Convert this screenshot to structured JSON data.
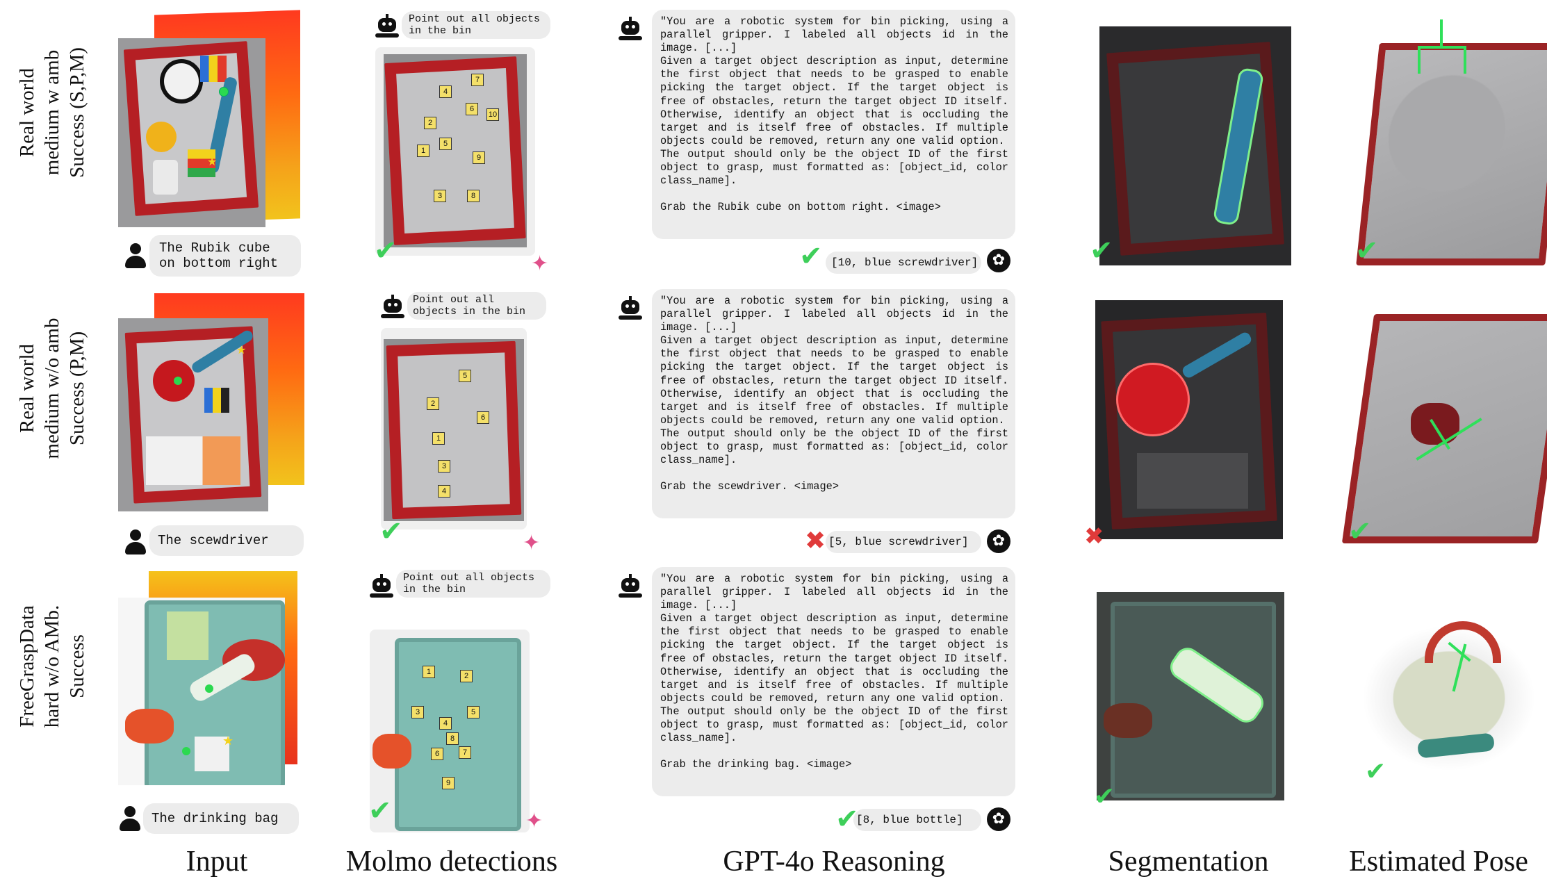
{
  "columns": {
    "input": "Input",
    "molmo": "Molmo detections",
    "gpt": "GPT-4o Reasoning",
    "seg": "Segmentation",
    "pose": "Estimated Pose"
  },
  "rows": [
    {
      "label": [
        "Real world",
        "medium w amb",
        "Success (S,P,M)"
      ],
      "user_query": [
        "The Rubik cube",
        "on bottom right"
      ],
      "molmo_prompt": [
        "Point out all objects",
        "in the bin"
      ],
      "gpt_prompt": "\"You are a robotic system for bin picking, using a parallel gripper. I labeled all objects id in the image. [...]\nGiven a target object description as input, determine the first object that needs to be grasped to enable picking the target object. If the target object is free of obstacles, return the target object ID itself. Otherwise, identify an object that is occluding the target and is itself free of obstacles. If multiple objects could be removed, return any one valid option.\nThe output should only be the object ID of the first object to grasp, must formatted as: [object_id, color class_name].\n\nGrab the Rubik cube on bottom right. <image>",
      "gpt_answer": "[10, blue screwdriver]",
      "gpt_mark": "check",
      "seg_mark": "check",
      "pose_mark": "check",
      "molmo_mark": "check",
      "tags": [
        "1",
        "2",
        "3",
        "4",
        "5",
        "6",
        "7",
        "8",
        "9",
        "10"
      ]
    },
    {
      "label": [
        "Real world",
        "medium w/o amb",
        "Success (P,M)"
      ],
      "user_query": [
        "The scewdriver"
      ],
      "molmo_prompt": [
        "Point out all",
        "objects in the bin"
      ],
      "gpt_prompt": "\"You are a robotic system for bin picking, using a parallel gripper. I labeled all objects id in the image. [...]\nGiven a target object description as input, determine the first object that needs to be grasped to enable picking the target object. If the target object is free of obstacles, return the target object ID itself. Otherwise, identify an object that is occluding the target and is itself free of obstacles. If multiple objects could be removed, return any one valid option.\nThe output should only be the object ID of the first object to grasp, must formatted as: [object_id, color class_name].\n\nGrab the scewdriver. <image>",
      "gpt_answer": "[5, blue screwdriver]",
      "gpt_mark": "cross",
      "seg_mark": "cross",
      "pose_mark": "check",
      "molmo_mark": "check",
      "tags": [
        "1",
        "2",
        "3",
        "4",
        "5",
        "6"
      ]
    },
    {
      "label": [
        "FreeGraspData",
        "hard w/o AMb.",
        "Success"
      ],
      "user_query": [
        "The drinking bag"
      ],
      "molmo_prompt": [
        "Point out all objects",
        "in the bin"
      ],
      "gpt_prompt": "\"You are a robotic system for bin picking, using a parallel gripper. I labeled all objects id in the image. [...]\nGiven a target object description as input, determine the first object that needs to be grasped to enable picking the target object. If the target object is free of obstacles, return the target object ID itself. Otherwise, identify an object that is occluding the target and is itself free of obstacles. If multiple objects could be removed, return any one valid option.\nThe output should only be the object ID of the first object to grasp, must formatted as: [object_id, color class_name].\n\nGrab the drinking bag. <image>",
      "gpt_answer": "[8, blue bottle]",
      "gpt_mark": "check",
      "seg_mark": "check",
      "pose_mark": "check",
      "molmo_mark": "check",
      "tags": [
        "1",
        "2",
        "3",
        "4",
        "5",
        "6",
        "7",
        "8",
        "9"
      ]
    }
  ],
  "colors": {
    "check": "#3ecf5a",
    "cross": "#e03a3a",
    "bin_red": "#b51f24",
    "bubble": "#ececec",
    "molmo_star": "#e0508a"
  }
}
